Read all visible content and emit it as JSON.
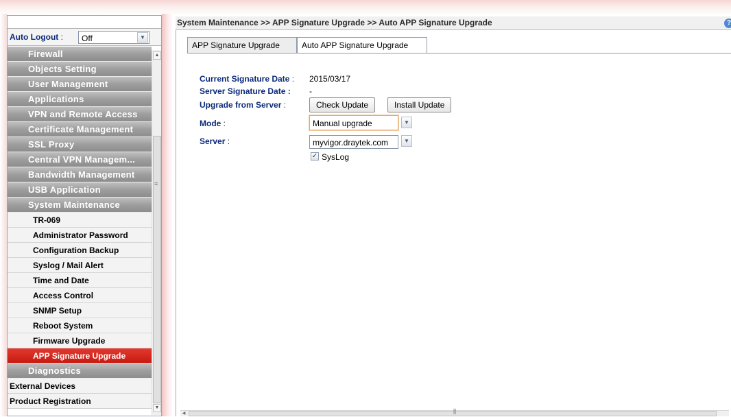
{
  "breadcrumb": "System Maintenance >> APP Signature Upgrade >> Auto APP Signature Upgrade",
  "help_icon": "?",
  "sidebar": {
    "auto_logout_label": "Auto Logout",
    "auto_logout_colon": " :",
    "auto_logout_value": "Off",
    "categories": [
      "Firewall",
      "Objects Setting",
      "User Management",
      "Applications",
      "VPN and Remote Access",
      "Certificate Management",
      "SSL Proxy",
      "Central VPN Managem...",
      "Bandwidth Management",
      "USB Application",
      "System Maintenance"
    ],
    "sub_items": [
      "TR-069",
      "Administrator Password",
      "Configuration Backup",
      "Syslog / Mail Alert",
      "Time and Date",
      "Access Control",
      "SNMP Setup",
      "Reboot System",
      "Firmware Upgrade",
      "APP Signature Upgrade"
    ],
    "after_categories": [
      "Diagnostics"
    ],
    "plain_items": [
      "External Devices",
      "Product Registration"
    ]
  },
  "tabs": [
    {
      "label": "APP Signature Upgrade"
    },
    {
      "label": "Auto APP Signature Upgrade"
    }
  ],
  "form": {
    "current_sig_label": "Current Signature Date",
    "current_sig_colon": " :",
    "current_sig_value": "2015/03/17",
    "server_sig_label": "Server Signature Date :",
    "server_sig_value": "-",
    "upgrade_label": "Upgrade from Server",
    "upgrade_colon": " :",
    "check_update": "Check Update",
    "install_update": "Install Update",
    "mode_label": "Mode",
    "mode_colon": " :",
    "mode_value": "Manual upgrade",
    "server_label": "Server",
    "server_colon": " :",
    "server_value": "myvigor.draytek.com",
    "syslog_label": "SysLog",
    "syslog_checked": true
  }
}
